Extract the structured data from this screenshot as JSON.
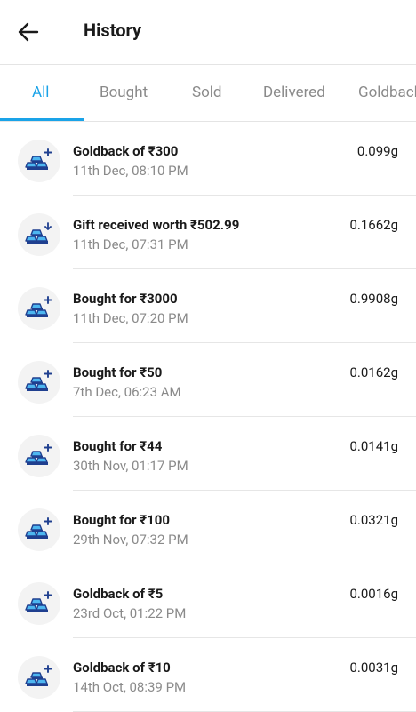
{
  "header": {
    "title": "History"
  },
  "tabs": [
    {
      "label": "All",
      "active": true
    },
    {
      "label": "Bought",
      "active": false
    },
    {
      "label": "Sold",
      "active": false
    },
    {
      "label": "Delivered",
      "active": false
    },
    {
      "label": "Goldback",
      "active": false
    }
  ],
  "accent_color": "#1aa3e8",
  "transactions": [
    {
      "title": "Goldback of ₹300",
      "date": "11th Dec, 08:10 PM",
      "amount": "0.099g",
      "icon": "gold-bars-plus-icon"
    },
    {
      "title": "Gift received worth ₹502.99",
      "date": "11th Dec, 07:31 PM",
      "amount": "0.1662g",
      "icon": "gold-bars-received-icon"
    },
    {
      "title": "Bought for ₹3000",
      "date": "11th Dec, 07:20 PM",
      "amount": "0.9908g",
      "icon": "gold-bars-plus-icon"
    },
    {
      "title": "Bought for ₹50",
      "date": "7th Dec, 06:23 AM",
      "amount": "0.0162g",
      "icon": "gold-bars-plus-icon"
    },
    {
      "title": "Bought for ₹44",
      "date": "30th Nov, 01:17 PM",
      "amount": "0.0141g",
      "icon": "gold-bars-plus-icon"
    },
    {
      "title": "Bought for ₹100",
      "date": "29th Nov, 07:32 PM",
      "amount": "0.0321g",
      "icon": "gold-bars-plus-icon"
    },
    {
      "title": "Goldback of ₹5",
      "date": "23rd Oct, 01:22 PM",
      "amount": "0.0016g",
      "icon": "gold-bars-plus-icon"
    },
    {
      "title": "Goldback of ₹10",
      "date": "14th Oct, 08:39 PM",
      "amount": "0.0031g",
      "icon": "gold-bars-plus-icon"
    }
  ]
}
